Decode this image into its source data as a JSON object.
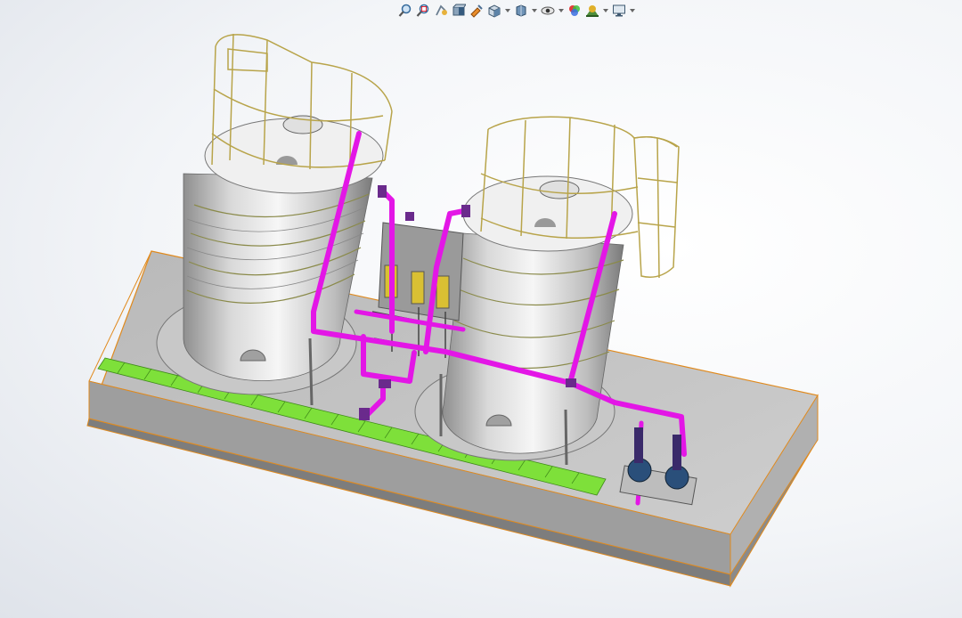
{
  "toolbar": {
    "items": [
      {
        "icon": "zoom-to-fit-icon",
        "dropdown": false
      },
      {
        "icon": "zoom-to-area-icon",
        "dropdown": false
      },
      {
        "icon": "previous-view-icon",
        "dropdown": false
      },
      {
        "icon": "section-view-icon",
        "dropdown": false
      },
      {
        "icon": "dynamic-annotation-view-icon",
        "dropdown": false
      },
      {
        "icon": "view-orientation-icon",
        "dropdown": true
      },
      {
        "icon": "display-style-icon",
        "dropdown": true
      },
      {
        "icon": "hide-show-items-icon",
        "dropdown": true
      },
      {
        "icon": "edit-appearance-icon",
        "dropdown": false
      },
      {
        "icon": "apply-scene-icon",
        "dropdown": true
      },
      {
        "icon": "view-settings-icon",
        "dropdown": true
      }
    ]
  },
  "model": {
    "name": "twin-storage-tank-skid",
    "colors": {
      "pipe": "#e316e6",
      "tank_body": "#d6d6d6",
      "base": "#a9a9a9",
      "edge": "#e08a1e",
      "grating": "#7ee03a",
      "railing": "#b8a44a",
      "pump": "#2a4f7a"
    }
  }
}
